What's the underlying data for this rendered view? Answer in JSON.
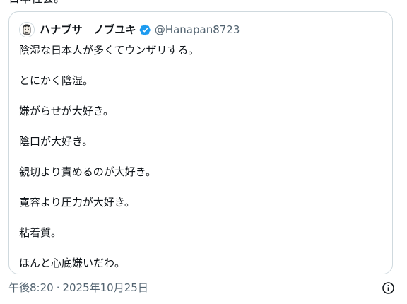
{
  "tweet": {
    "partial_text_above": "日本社会。"
  },
  "quote": {
    "author": {
      "display_name": "ハナブサ　ノブユキ",
      "handle": "@Hanapan8723",
      "verified": true,
      "avatar_icon": "cartoon-face-avatar"
    },
    "lines": [
      "陰湿な日本人が多くてウンザリする。",
      "とにかく陰湿。",
      "嫌がらせが大好き。",
      "陰口が大好き。",
      "親切より責めるのが大好き。",
      "寛容より圧力が大好き。",
      "粘着質。",
      "ほんと心底嫌いだわ。"
    ]
  },
  "meta": {
    "time": "午後8:20",
    "separator": "·",
    "date": "2025年10月25日",
    "info_icon": "info-circle-icon"
  },
  "colors": {
    "text": "#0f1419",
    "secondary": "#536471",
    "border": "#cfd9de",
    "verified_blue": "#1d9bf0"
  }
}
